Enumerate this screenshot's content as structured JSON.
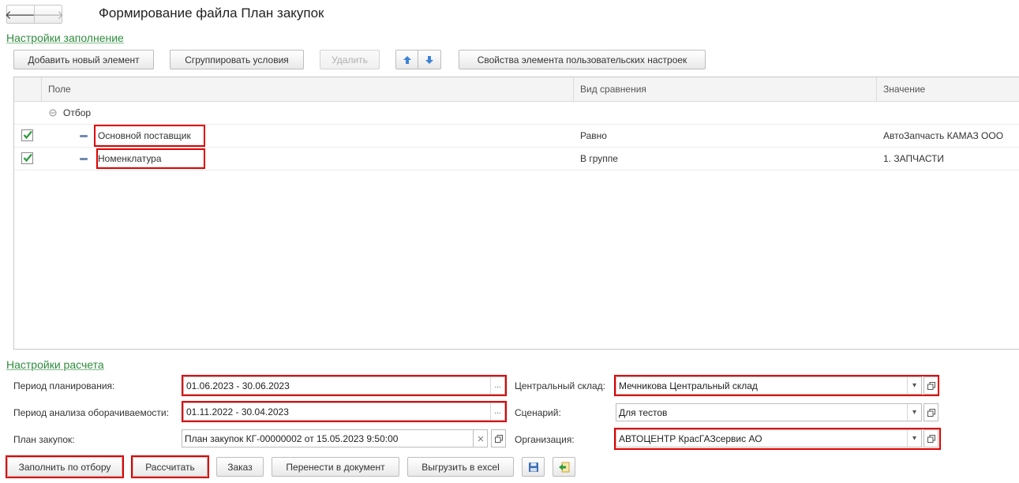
{
  "window": {
    "title": "Формирование файла План закупок"
  },
  "nav": {
    "back_glyph": "🡐",
    "forward_glyph": "🡒"
  },
  "settings_section": {
    "title": "Настройки заполнение",
    "toolbar": {
      "add_label": "Добавить новый элемент",
      "group_label": "Сгруппировать условия",
      "delete_label": "Удалить",
      "properties_label": "Свойства элемента пользовательских настроек"
    },
    "grid": {
      "columns": [
        "Поле",
        "Вид сравнения",
        "Значение"
      ],
      "group_row": {
        "label": "Отбор"
      },
      "rows": [
        {
          "checked": true,
          "field": "Основной поставщик",
          "comparison": "Равно",
          "value": "АвтоЗапчасть КАМАЗ ООО"
        },
        {
          "checked": true,
          "field": "Номенклатура",
          "comparison": "В группе",
          "value": "1. ЗАПЧАСТИ"
        }
      ]
    }
  },
  "calc_section": {
    "title": "Настройки расчета",
    "planning_period": {
      "label": "Период планирования:",
      "value": "01.06.2023 - 30.06.2023"
    },
    "analysis_period": {
      "label": "Период анализа оборачиваемости:",
      "value": "01.11.2022 - 30.04.2023"
    },
    "purchase_plan": {
      "label": "План закупок:",
      "value": "План закупок КГ-00000002 от 15.05.2023 9:50:00"
    },
    "central_warehouse": {
      "label": "Центральный склад:",
      "value": "Мечникова Центральный склад"
    },
    "scenario": {
      "label": "Сценарий:",
      "value": "Для тестов"
    },
    "organization": {
      "label": "Организация:",
      "value": "АВТОЦЕНТР КрасГАЗсервис АО"
    }
  },
  "bottom_toolbar": {
    "fill_label": "Заполнить по отбору",
    "calc_label": "Рассчитать",
    "order_label": "Заказ",
    "transfer_label": "Перенести в документ",
    "export_label": "Выгрузить в excel"
  },
  "colors": {
    "highlight": "#e00000",
    "link": "#2e8b3d",
    "check": "#2e9a3e"
  }
}
